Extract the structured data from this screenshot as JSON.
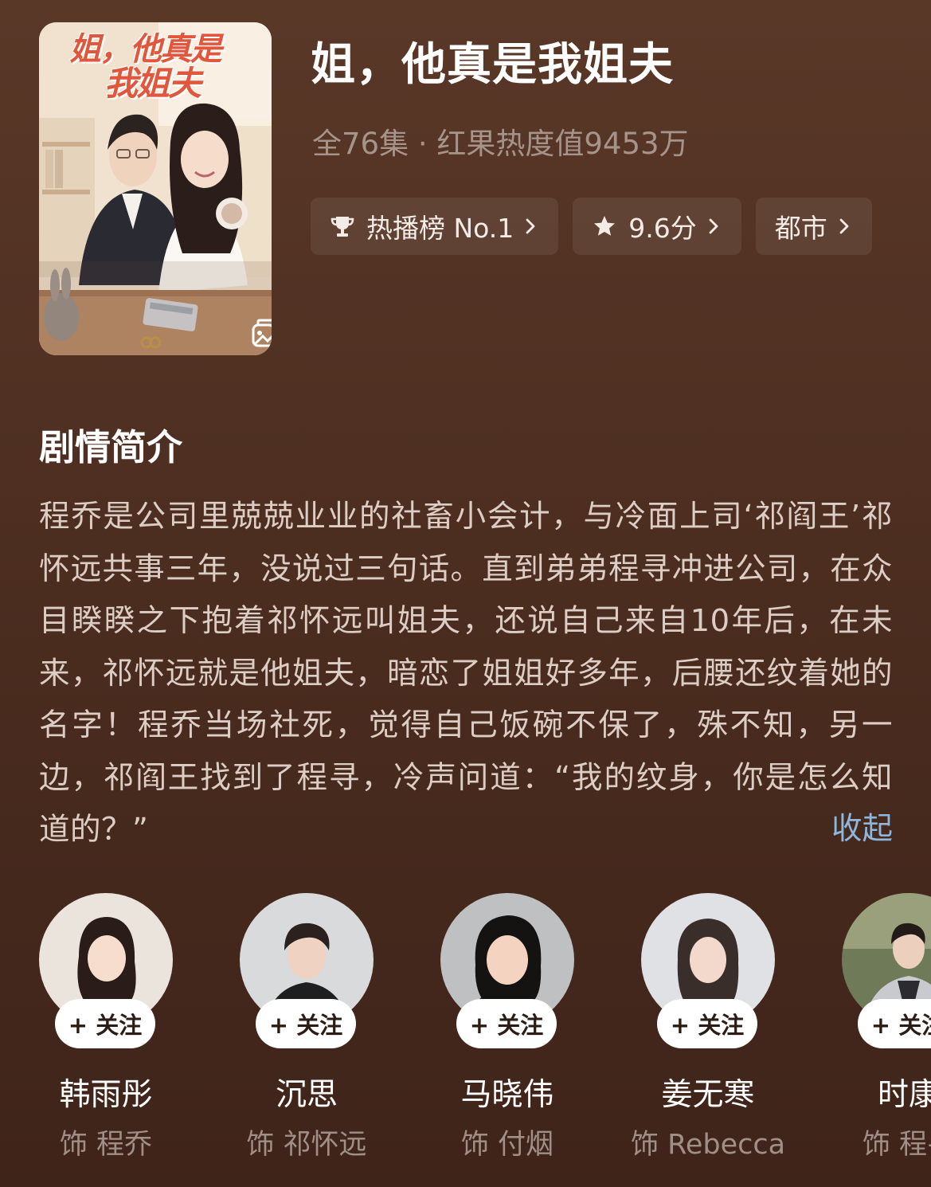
{
  "drama": {
    "title": "姐，他真是我姐夫",
    "meta": "全76集 · 红果热度值9453万",
    "poster_title_line1": "姐，他真是",
    "poster_title_line2": "我姐夫",
    "tags": [
      {
        "icon": "trophy-icon",
        "label": "热播榜 No.1"
      },
      {
        "icon": "star-icon",
        "label": "9.6分"
      },
      {
        "icon": "",
        "label": "都市"
      }
    ]
  },
  "synopsis": {
    "heading": "剧情简介",
    "text": "程乔是公司里兢兢业业的社畜小会计，与冷面上司‘祁阎王’祁怀远共事三年，没说过三句话。直到弟弟程寻冲进公司，在众目睽睽之下抱着祁怀远叫姐夫，还说自己来自10年后，在未来，祁怀远就是他姐夫，暗恋了姐姐好多年，后腰还纹着她的名字！程乔当场社死，觉得自己饭碗不保了，殊不知，另一边，祁阎王找到了程寻，冷声问道：“我的纹身，你是怎么知道的？”",
    "collapse_label": "收起"
  },
  "cast": [
    {
      "name": "韩雨彤",
      "role": "饰 程乔",
      "follow_label": "+ 关注"
    },
    {
      "name": "沉思",
      "role": "饰 祁怀远",
      "follow_label": "+ 关注"
    },
    {
      "name": "马晓伟",
      "role": "饰 付烟",
      "follow_label": "+ 关注"
    },
    {
      "name": "姜无寒",
      "role": "饰 Rebecca",
      "follow_label": "+ 关注"
    },
    {
      "name": "时康",
      "role": "饰 程寻",
      "follow_label": "+ 关注"
    }
  ],
  "colors": {
    "background": "#4f3022",
    "accent_link": "#8fb6dc",
    "muted_text": "#a6948b"
  }
}
